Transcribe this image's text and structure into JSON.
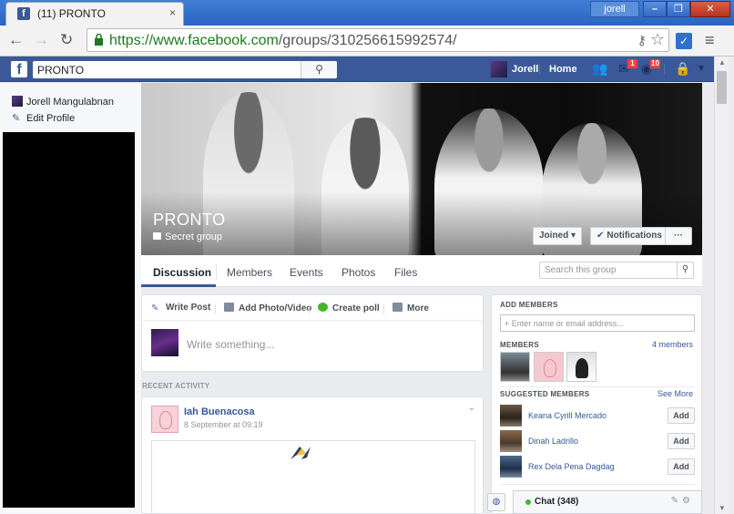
{
  "browser": {
    "tab_title": "(11) PRONTO",
    "tab_close": "×",
    "profile_name": "jorell",
    "url_host": "https://www.facebook.com",
    "url_path": "/groups/310256615992574/"
  },
  "fb": {
    "search_value": "PRONTO",
    "user_name": "Jorell",
    "home_label": "Home",
    "messages_badge": "1",
    "notifications_badge": "10"
  },
  "left_nav": {
    "user_name": "Jorell Mangulabnan",
    "edit_profile": "Edit Profile"
  },
  "group": {
    "name": "PRONTO",
    "privacy": "Secret group",
    "joined_label": "Joined",
    "notifications_label": "Notifications",
    "more_label": "···",
    "tabs": [
      "Discussion",
      "Members",
      "Events",
      "Photos",
      "Files"
    ],
    "search_placeholder": "Search this group"
  },
  "composer": {
    "write_post": "Write Post",
    "add_photo": "Add Photo/Video",
    "create_poll": "Create poll",
    "more": "More",
    "placeholder": "Write something..."
  },
  "recent": {
    "label": "RECENT ACTIVITY",
    "post_author": "Iah Buenacosa",
    "post_time": "8 September at 09:19"
  },
  "sidebar": {
    "add_members_heading": "ADD MEMBERS",
    "add_members_placeholder": "+ Enter name or email address...",
    "members_heading": "MEMBERS",
    "members_count": "4 members",
    "suggested_heading": "SUGGESTED MEMBERS",
    "see_more": "See More",
    "suggested": [
      {
        "name": "Keana Cyrill Mercado",
        "button": "Add"
      },
      {
        "name": "Dinah Ladrillo",
        "button": "Add"
      },
      {
        "name": "Rex Dela Pena Dagdag",
        "button": "Add"
      }
    ]
  },
  "chat": {
    "label": "Chat (348)"
  }
}
